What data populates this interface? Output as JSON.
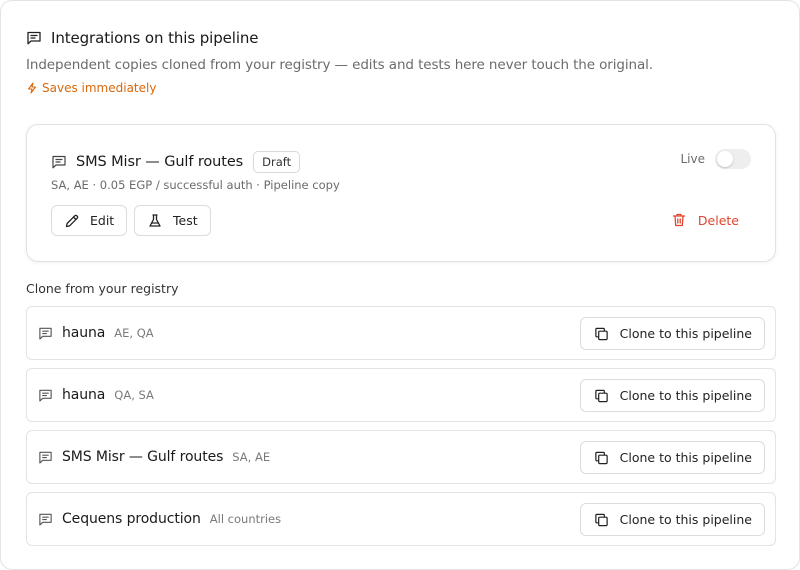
{
  "header": {
    "title": "Integrations on this pipeline",
    "subtitle": "Independent copies cloned from your registry — edits and tests here never touch the original.",
    "saves_label": "Saves immediately",
    "accent_color": "#d9680c"
  },
  "pipeline_card": {
    "name": "SMS Misr — Gulf routes",
    "badge": "Draft",
    "meta": "SA, AE · 0.05 EGP / successful auth · Pipeline copy",
    "live_label": "Live",
    "live_enabled": false,
    "edit_label": "Edit",
    "test_label": "Test",
    "delete_label": "Delete",
    "delete_color": "#e0452d"
  },
  "registry": {
    "section_label": "Clone from your registry",
    "items": [
      {
        "name": "hauna",
        "countries": "AE, QA",
        "action_label": "Clone to this pipeline"
      },
      {
        "name": "hauna",
        "countries": "QA, SA",
        "action_label": "Clone to this pipeline"
      },
      {
        "name": "SMS Misr — Gulf routes",
        "countries": "SA, AE",
        "action_label": "Clone to this pipeline"
      },
      {
        "name": "Cequens production",
        "countries": "All countries",
        "action_label": "Clone to this pipeline"
      }
    ]
  },
  "icons": {
    "integration": "message-square-icon",
    "saves": "lightning-bolt-icon",
    "edit": "pencil-icon",
    "test": "flask-icon",
    "delete": "trash-icon",
    "clone": "copy-icon"
  }
}
